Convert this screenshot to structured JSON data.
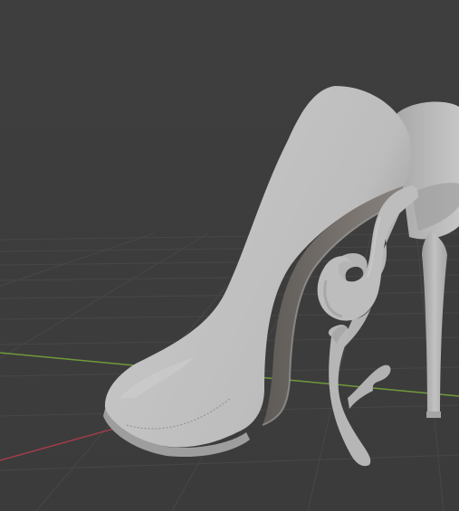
{
  "viewport": {
    "background_color": "#3d3d3d",
    "grid_line_color": "#4a4a4a",
    "x_axis_color": "#a33d4b",
    "y_axis_color": "#6f9a3a",
    "model_color": "#b9b9b9",
    "model_shadow_color": "#6e6a66"
  },
  "scene": {
    "object": "high-heel-shoe-model",
    "shading": "solid"
  }
}
